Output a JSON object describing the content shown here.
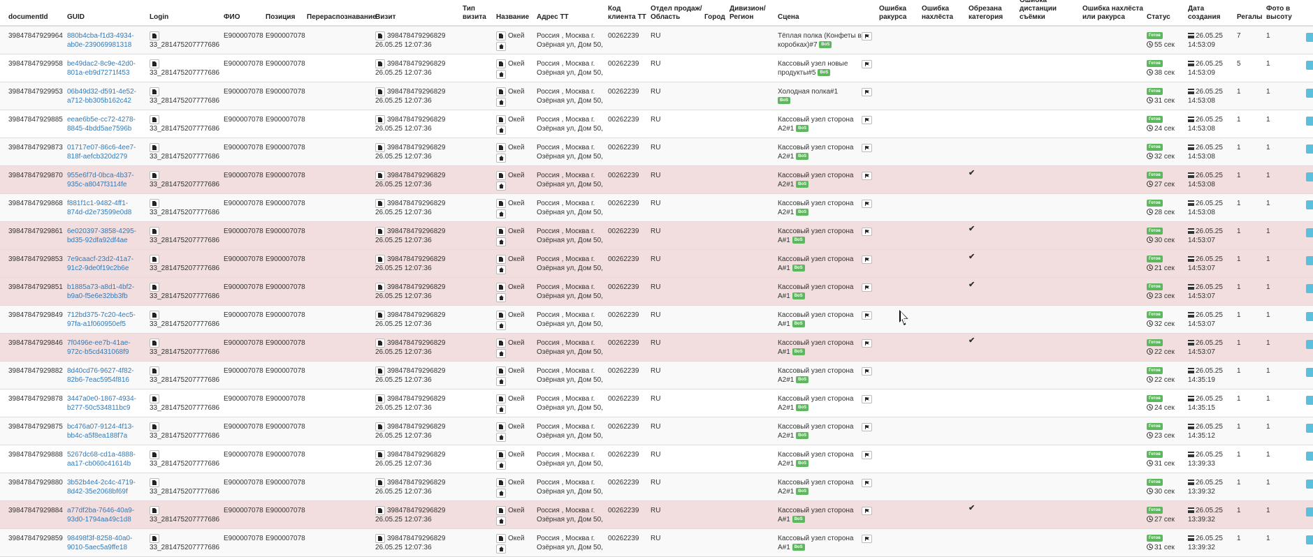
{
  "columns": {
    "documentId": "documentId",
    "guid": "GUID",
    "login": "Login",
    "fio": "ФИО",
    "position": "Позиция",
    "redistribution": "Перераспознавание",
    "visit": "Визит",
    "visit_type": "Тип визита",
    "name": "Название",
    "address": "Адрес ТТ",
    "client_code": "Код клиента ТТ",
    "sales_dept": "Отдел продаж/ Область",
    "city": "Город",
    "division": "Дивизион/ Регион",
    "scene": "Сцена",
    "angle_error": "Ошибка ракурса",
    "overlap_error": "Ошибка нахлёста",
    "cut_category": "Обрезана категория",
    "distance_error": "Ошибка дистанции съёмки",
    "overlap_angle_error": "Ошибка нахлёста или ракурса",
    "status": "Статус",
    "created": "Дата создания",
    "shelves": "Регалы",
    "height_photo": "Фото в высоту"
  },
  "rows": [
    {
      "documentId": "39847847929964",
      "guid": "880b4cba-f1d3-4934-ab0e-239069981318",
      "login": "33_281475207777686",
      "fio": "E900007078",
      "position": "E900007078",
      "visit": "398478479296829",
      "visit_date": "26.05.25 12:07:36",
      "name": "Окей",
      "address1": "Россия , Москва г.",
      "address2": "Озёрная ул, Дом 50,",
      "client_code": "00262239",
      "sales_dept": "RU",
      "scene1": "Тёплая полка (Конфеты в",
      "scene2": "коробках)#7",
      "badge": "BoS",
      "cut": "",
      "status": "Готов",
      "duration": "55 сек",
      "date": "26.05.25",
      "time": "14:53:09",
      "shelves": "7",
      "height": "1",
      "hl": false
    },
    {
      "documentId": "39847847929958",
      "guid": "be49dac2-8c9e-42d0-801a-eb9d7271f453",
      "login": "33_281475207777686",
      "fio": "E900007078",
      "position": "E900007078",
      "visit": "398478479296829",
      "visit_date": "26.05.25 12:07:36",
      "name": "Окей",
      "address1": "Россия , Москва г.",
      "address2": "Озёрная ул, Дом 50,",
      "client_code": "00262239",
      "sales_dept": "RU",
      "scene1": "Кассовый узел новые",
      "scene2": "продукты#5",
      "badge": "BoS",
      "cut": "",
      "status": "Готов",
      "duration": "38 сек",
      "date": "26.05.25",
      "time": "14:53:09",
      "shelves": "5",
      "height": "1",
      "hl": false
    },
    {
      "documentId": "39847847929953",
      "guid": "06b49d32-d591-4e52-a712-bb305b162c42",
      "login": "33_281475207777686",
      "fio": "E900007078",
      "position": "E900007078",
      "visit": "398478479296829",
      "visit_date": "26.05.25 12:07:36",
      "name": "Окей",
      "address1": "Россия , Москва г.",
      "address2": "Озёрная ул, Дом 50,",
      "client_code": "00262239",
      "sales_dept": "RU",
      "scene1": "Холодная полка#1",
      "scene2": "",
      "badge": "BoS",
      "cut": "",
      "status": "Готов",
      "duration": "31 сек",
      "date": "26.05.25",
      "time": "14:53:08",
      "shelves": "1",
      "height": "1",
      "hl": false
    },
    {
      "documentId": "39847847929885",
      "guid": "eeae6b5e-cc72-4278-8845-4bdd5ae7596b",
      "login": "33_281475207777686",
      "fio": "E900007078",
      "position": "E900007078",
      "visit": "398478479296829",
      "visit_date": "26.05.25 12:07:36",
      "name": "Окей",
      "address1": "Россия , Москва г.",
      "address2": "Озёрная ул, Дом 50,",
      "client_code": "00262239",
      "sales_dept": "RU",
      "scene1": "Кассовый узел сторона",
      "scene2": "A2#1",
      "badge": "BoS",
      "cut": "",
      "status": "Готов",
      "duration": "24 сек",
      "date": "26.05.25",
      "time": "14:53:08",
      "shelves": "1",
      "height": "1",
      "hl": false
    },
    {
      "documentId": "39847847929873",
      "guid": "01717e07-86c6-4ee7-818f-aefcb320d279",
      "login": "33_281475207777686",
      "fio": "E900007078",
      "position": "E900007078",
      "visit": "398478479296829",
      "visit_date": "26.05.25 12:07:36",
      "name": "Окей",
      "address1": "Россия , Москва г.",
      "address2": "Озёрная ул, Дом 50,",
      "client_code": "00262239",
      "sales_dept": "RU",
      "scene1": "Кассовый узел сторона",
      "scene2": "A2#1",
      "badge": "BoS",
      "cut": "",
      "status": "Готов",
      "duration": "32 сек",
      "date": "26.05.25",
      "time": "14:53:08",
      "shelves": "1",
      "height": "1",
      "hl": false
    },
    {
      "documentId": "39847847929870",
      "guid": "955e6f7d-0bca-4b37-935c-a8047f3114fe",
      "login": "33_281475207777686",
      "fio": "E900007078",
      "position": "E900007078",
      "visit": "398478479296829",
      "visit_date": "26.05.25 12:07:36",
      "name": "Окей",
      "address1": "Россия , Москва г.",
      "address2": "Озёрная ул, Дом 50,",
      "client_code": "00262239",
      "sales_dept": "RU",
      "scene1": "Кассовый узел сторона",
      "scene2": "A2#1",
      "badge": "BoS",
      "cut": "✔",
      "status": "Готов",
      "duration": "27 сек",
      "date": "26.05.25",
      "time": "14:53:08",
      "shelves": "1",
      "height": "1",
      "hl": true
    },
    {
      "documentId": "39847847929868",
      "guid": "f881f1c1-9482-4ff1-874d-d2e73599e0d8",
      "login": "33_281475207777686",
      "fio": "E900007078",
      "position": "E900007078",
      "visit": "398478479296829",
      "visit_date": "26.05.25 12:07:36",
      "name": "Окей",
      "address1": "Россия , Москва г.",
      "address2": "Озёрная ул, Дом 50,",
      "client_code": "00262239",
      "sales_dept": "RU",
      "scene1": "Кассовый узел сторона",
      "scene2": "A2#1",
      "badge": "BoS",
      "cut": "",
      "status": "Готов",
      "duration": "28 сек",
      "date": "26.05.25",
      "time": "14:53:08",
      "shelves": "1",
      "height": "1",
      "hl": false
    },
    {
      "documentId": "39847847929861",
      "guid": "6e020397-3858-4295-bd35-92dfa92df4ae",
      "login": "33_281475207777686",
      "fio": "E900007078",
      "position": "E900007078",
      "visit": "398478479296829",
      "visit_date": "26.05.25 12:07:36",
      "name": "Окей",
      "address1": "Россия , Москва г.",
      "address2": "Озёрная ул, Дом 50,",
      "client_code": "00262239",
      "sales_dept": "RU",
      "scene1": "Кассовый узел сторона",
      "scene2": "A#1",
      "badge": "BoS",
      "cut": "✔",
      "status": "Готов",
      "duration": "30 сек",
      "date": "26.05.25",
      "time": "14:53:07",
      "shelves": "1",
      "height": "1",
      "hl": true
    },
    {
      "documentId": "39847847929853",
      "guid": "7e9caacf-23d2-41a7-91c2-9de0f19c2b6e",
      "login": "33_281475207777686",
      "fio": "E900007078",
      "position": "E900007078",
      "visit": "398478479296829",
      "visit_date": "26.05.25 12:07:36",
      "name": "Окей",
      "address1": "Россия , Москва г.",
      "address2": "Озёрная ул, Дом 50,",
      "client_code": "00262239",
      "sales_dept": "RU",
      "scene1": "Кассовый узел сторона",
      "scene2": "A#1",
      "badge": "BoS",
      "cut": "✔",
      "status": "Готов",
      "duration": "21 сек",
      "date": "26.05.25",
      "time": "14:53:07",
      "shelves": "1",
      "height": "1",
      "hl": true
    },
    {
      "documentId": "39847847929851",
      "guid": "b1885a73-a8d1-4bf2-b9a0-f5e6e32bb3fb",
      "login": "33_281475207777686",
      "fio": "E900007078",
      "position": "E900007078",
      "visit": "398478479296829",
      "visit_date": "26.05.25 12:07:36",
      "name": "Окей",
      "address1": "Россия , Москва г.",
      "address2": "Озёрная ул, Дом 50,",
      "client_code": "00262239",
      "sales_dept": "RU",
      "scene1": "Кассовый узел сторона",
      "scene2": "A#1",
      "badge": "BoS",
      "cut": "✔",
      "status": "Готов",
      "duration": "23 сек",
      "date": "26.05.25",
      "time": "14:53:07",
      "shelves": "1",
      "height": "1",
      "hl": true
    },
    {
      "documentId": "39847847929849",
      "guid": "712bd375-7c20-4ec5-97fa-a1f060950ef5",
      "login": "33_281475207777686",
      "fio": "E900007078",
      "position": "E900007078",
      "visit": "398478479296829",
      "visit_date": "26.05.25 12:07:36",
      "name": "Окей",
      "address1": "Россия , Москва г.",
      "address2": "Озёрная ул, Дом 50,",
      "client_code": "00262239",
      "sales_dept": "RU",
      "scene1": "Кассовый узел сторона",
      "scene2": "A#1",
      "badge": "BoS",
      "cut": "",
      "status": "Готов",
      "duration": "32 сек",
      "date": "26.05.25",
      "time": "14:53:07",
      "shelves": "1",
      "height": "1",
      "hl": false
    },
    {
      "documentId": "39847847929846",
      "guid": "7f0496e-ee7b-41ae-972c-b5cd431068f9",
      "login": "33_281475207777686",
      "fio": "E900007078",
      "position": "E900007078",
      "visit": "398478479296829",
      "visit_date": "26.05.25 12:07:36",
      "name": "Окей",
      "address1": "Россия , Москва г.",
      "address2": "Озёрная ул, Дом 50,",
      "client_code": "00262239",
      "sales_dept": "RU",
      "scene1": "Кассовый узел сторона",
      "scene2": "A#1",
      "badge": "BoS",
      "cut": "✔",
      "status": "Готов",
      "duration": "22 сек",
      "date": "26.05.25",
      "time": "14:53:07",
      "shelves": "1",
      "height": "1",
      "hl": true
    },
    {
      "documentId": "39847847929882",
      "guid": "8d40cd76-9627-4f82-82b6-7eac5954f816",
      "login": "33_281475207777686",
      "fio": "E900007078",
      "position": "E900007078",
      "visit": "398478479296829",
      "visit_date": "26.05.25 12:07:36",
      "name": "Окей",
      "address1": "Россия , Москва г.",
      "address2": "Озёрная ул, Дом 50,",
      "client_code": "00262239",
      "sales_dept": "RU",
      "scene1": "Кассовый узел сторона",
      "scene2": "A2#1",
      "badge": "BoS",
      "cut": "",
      "status": "Готов",
      "duration": "22 сек",
      "date": "26.05.25",
      "time": "14:35:19",
      "shelves": "1",
      "height": "1",
      "hl": false
    },
    {
      "documentId": "39847847929878",
      "guid": "3447a0e0-1867-4934-b277-50c534811bc9",
      "login": "33_281475207777686",
      "fio": "E900007078",
      "position": "E900007078",
      "visit": "398478479296829",
      "visit_date": "26.05.25 12:07:36",
      "name": "Окей",
      "address1": "Россия , Москва г.",
      "address2": "Озёрная ул, Дом 50,",
      "client_code": "00262239",
      "sales_dept": "RU",
      "scene1": "Кассовый узел сторона",
      "scene2": "A2#1",
      "badge": "BoS",
      "cut": "",
      "status": "Готов",
      "duration": "24 сек",
      "date": "26.05.25",
      "time": "14:35:15",
      "shelves": "1",
      "height": "1",
      "hl": false
    },
    {
      "documentId": "39847847929875",
      "guid": "bc476a07-9124-4f13-bb4c-a5f8ea188f7a",
      "login": "33_281475207777686",
      "fio": "E900007078",
      "position": "E900007078",
      "visit": "398478479296829",
      "visit_date": "26.05.25 12:07:36",
      "name": "Окей",
      "address1": "Россия , Москва г.",
      "address2": "Озёрная ул, Дом 50,",
      "client_code": "00262239",
      "sales_dept": "RU",
      "scene1": "Кассовый узел сторона",
      "scene2": "A2#1",
      "badge": "BoS",
      "cut": "",
      "status": "Готов",
      "duration": "23 сек",
      "date": "26.05.25",
      "time": "14:35:12",
      "shelves": "1",
      "height": "1",
      "hl": false
    },
    {
      "documentId": "39847847929888",
      "guid": "5267dc68-cd1a-4888-aa17-cb060c41614b",
      "login": "33_281475207777686",
      "fio": "E900007078",
      "position": "E900007078",
      "visit": "398478479296829",
      "visit_date": "26.05.25 12:07:36",
      "name": "Окей",
      "address1": "Россия , Москва г.",
      "address2": "Озёрная ул, Дом 50,",
      "client_code": "00262239",
      "sales_dept": "RU",
      "scene1": "Кассовый узел сторона",
      "scene2": "A2#1",
      "badge": "BoS",
      "cut": "",
      "status": "Готов",
      "duration": "31 сек",
      "date": "26.05.25",
      "time": "13:39:33",
      "shelves": "1",
      "height": "1",
      "hl": false
    },
    {
      "documentId": "39847847929880",
      "guid": "3b52b4e4-2c4c-4719-8d42-35e2068bf69f",
      "login": "33_281475207777686",
      "fio": "E900007078",
      "position": "E900007078",
      "visit": "398478479296829",
      "visit_date": "26.05.25 12:07:36",
      "name": "Окей",
      "address1": "Россия , Москва г.",
      "address2": "Озёрная ул, Дом 50,",
      "client_code": "00262239",
      "sales_dept": "RU",
      "scene1": "Кассовый узел сторона",
      "scene2": "A2#1",
      "badge": "BoS",
      "cut": "",
      "status": "Готов",
      "duration": "30 сек",
      "date": "26.05.25",
      "time": "13:39:32",
      "shelves": "1",
      "height": "1",
      "hl": false
    },
    {
      "documentId": "39847847929884",
      "guid": "a77df2ba-7646-40a9-93d0-1794aa49c1d8",
      "login": "33_281475207777686",
      "fio": "E900007078",
      "position": "E900007078",
      "visit": "398478479296829",
      "visit_date": "26.05.25 12:07:36",
      "name": "Окей",
      "address1": "Россия , Москва г.",
      "address2": "Озёрная ул, Дом 50,",
      "client_code": "00262239",
      "sales_dept": "RU",
      "scene1": "Кассовый узел сторона",
      "scene2": "A#1",
      "badge": "BoS",
      "cut": "✔",
      "status": "Готов",
      "duration": "27 сек",
      "date": "26.05.25",
      "time": "13:39:32",
      "shelves": "1",
      "height": "1",
      "hl": true
    },
    {
      "documentId": "39847847929859",
      "guid": "98498f3f-8258-40a0-9010-5aec5a9ffe18",
      "login": "33_281475207777686",
      "fio": "E900007078",
      "position": "E900007078",
      "visit": "398478479296829",
      "visit_date": "26.05.25 12:07:36",
      "name": "Окей",
      "address1": "Россия , Москва г.",
      "address2": "Озёрная ул, Дом 50,",
      "client_code": "00262239",
      "sales_dept": "RU",
      "scene1": "Кассовый узел сторона",
      "scene2": "A#1",
      "badge": "BoS",
      "cut": "",
      "status": "Готов",
      "duration": "31 сек",
      "date": "26.05.25",
      "time": "13:39:32",
      "shelves": "1",
      "height": "1",
      "hl": false
    }
  ]
}
